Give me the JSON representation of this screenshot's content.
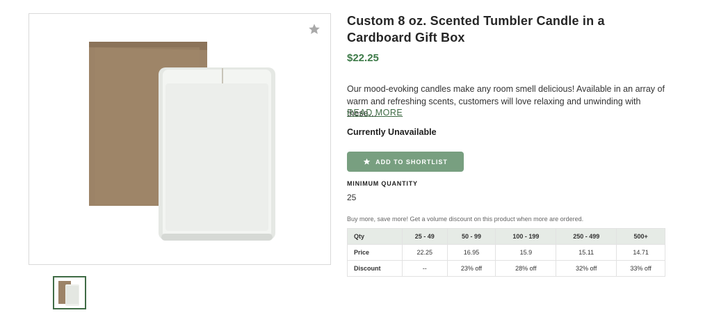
{
  "product": {
    "title": "Custom 8 oz. Scented Tumbler Candle in a Cardboard Gift Box",
    "price": "$22.25",
    "description": "Our mood-evoking candles make any room smell delicious! Available in an array of warm and refreshing scents, customers will love relaxing and unwinding with these…",
    "read_more": "READ MORE",
    "availability": "Currently Unavailable"
  },
  "actions": {
    "shortlist_label": "ADD TO SHORTLIST",
    "shortlist_icon": "star-icon",
    "favorite_icon": "star-icon"
  },
  "minimum_quantity": {
    "label": "MINIMUM QUANTITY",
    "value": "25"
  },
  "pricing": {
    "note": "Buy more, save more! Get a volume discount on this product when more are ordered.",
    "header": [
      "Qty",
      "25 - 49",
      "50 - 99",
      "100 - 199",
      "250 - 499",
      "500+"
    ],
    "rows": [
      [
        "Price",
        "22.25",
        "16.95",
        "15.9",
        "15.11",
        "14.71"
      ],
      [
        "Discount",
        "--",
        "23% off",
        "28% off",
        "32% off",
        "33% off"
      ]
    ]
  },
  "colors": {
    "accent_green": "#3d7a48",
    "button_green": "#789f80",
    "table_header_bg": "#e6ebe6"
  }
}
